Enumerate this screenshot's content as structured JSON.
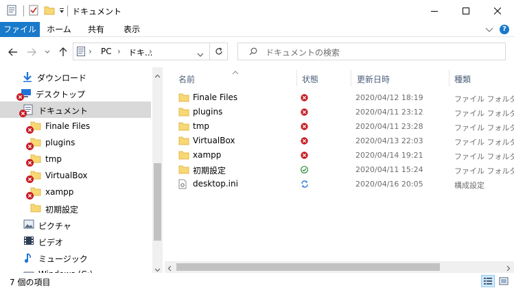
{
  "window": {
    "title": "ドキュメント"
  },
  "ribbon": {
    "tabs": [
      {
        "label": "ファイル"
      },
      {
        "label": "ホーム"
      },
      {
        "label": "共有"
      },
      {
        "label": "表示"
      }
    ]
  },
  "address": {
    "crumbs": [
      "PC",
      "ドキ..."
    ],
    "search_placeholder": "ドキュメントの検索"
  },
  "sidebar": {
    "items": [
      {
        "label": "ダウンロード",
        "icon": "download-icon",
        "badge": false
      },
      {
        "label": "デスクトップ",
        "icon": "desktop-icon",
        "badge": true
      },
      {
        "label": "ドキュメント",
        "icon": "documents-icon",
        "badge": true,
        "selected": true
      },
      {
        "label": "Finale Files",
        "icon": "folder-icon",
        "badge": true
      },
      {
        "label": "plugins",
        "icon": "folder-icon",
        "badge": true
      },
      {
        "label": "tmp",
        "icon": "folder-icon",
        "badge": true
      },
      {
        "label": "VirtualBox",
        "icon": "folder-icon",
        "badge": true
      },
      {
        "label": "xampp",
        "icon": "folder-icon",
        "badge": true
      },
      {
        "label": "初期設定",
        "icon": "folder-icon",
        "badge": false
      },
      {
        "label": "ピクチャ",
        "icon": "pictures-icon",
        "badge": false
      },
      {
        "label": "ビデオ",
        "icon": "videos-icon",
        "badge": false
      },
      {
        "label": "ミュージック",
        "icon": "music-icon",
        "badge": false
      },
      {
        "label": "Windows (C:)",
        "icon": "drive-icon",
        "badge": false
      }
    ]
  },
  "columns": {
    "name": "名前",
    "status": "状態",
    "modified": "更新日時",
    "type": "種類"
  },
  "files": [
    {
      "name": "Finale Files",
      "status": "error",
      "date": "2020/04/12 18:19",
      "type": "ファイル フォルダー",
      "icon": "folder-icon"
    },
    {
      "name": "plugins",
      "status": "error",
      "date": "2020/04/11 23:12",
      "type": "ファイル フォルダー",
      "icon": "folder-icon"
    },
    {
      "name": "tmp",
      "status": "error",
      "date": "2020/04/11 23:28",
      "type": "ファイル フォルダー",
      "icon": "folder-icon"
    },
    {
      "name": "VirtualBox",
      "status": "error",
      "date": "2020/04/13 22:03",
      "type": "ファイル フォルダー",
      "icon": "folder-icon"
    },
    {
      "name": "xampp",
      "status": "error",
      "date": "2020/04/14 19:21",
      "type": "ファイル フォルダー",
      "icon": "folder-icon"
    },
    {
      "name": "初期設定",
      "status": "synced",
      "date": "2020/04/11 15:24",
      "type": "ファイル フォルダー",
      "icon": "folder-icon"
    },
    {
      "name": "desktop.ini",
      "status": "syncing",
      "date": "2020/04/16 20:05",
      "type": "構成設定",
      "icon": "settings-file-icon"
    }
  ],
  "status": {
    "item_count": "7 個の項目"
  },
  "colors": {
    "accent": "#1979ca",
    "error": "#c81d25",
    "ok": "#2f8a3b",
    "sync": "#1e73d8",
    "folder": "#f8d775"
  }
}
